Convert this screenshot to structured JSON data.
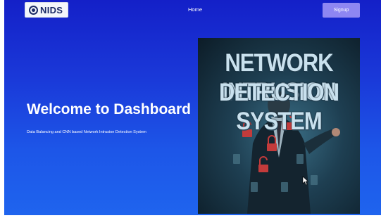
{
  "navbar": {
    "logo_text": "NIDS",
    "home_label": "Home",
    "signup_label": "Signup"
  },
  "hero": {
    "title": "Welcome to Dashboard",
    "subtitle": "Data Balancing and CNN based Network Intrusion Detection System",
    "image": {
      "line1": "NETWORK INTRUSION",
      "line2": "DETECTION SYSTEM"
    }
  },
  "colors": {
    "background_top": "#1420c8",
    "background_bottom": "#1f64ee",
    "signup_button": "#8e86f2",
    "logo_bg": "#f4f6fb"
  }
}
